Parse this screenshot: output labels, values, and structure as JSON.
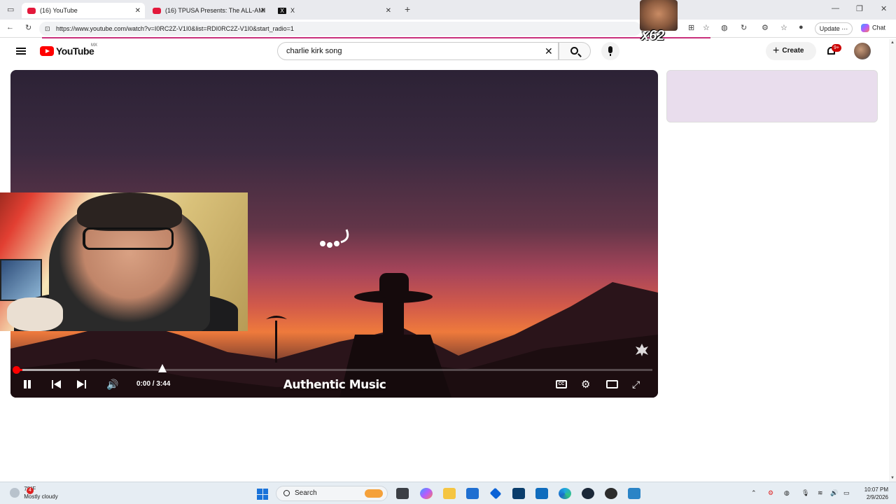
{
  "browser": {
    "tabs": [
      {
        "title": "(16) YouTube",
        "active": true
      },
      {
        "title": "(16) TPUSA Presents: The ALL-AMI",
        "active": false
      },
      {
        "title": "X",
        "active": false
      }
    ],
    "new_tab": "+",
    "url": "https://www.youtube.com/watch?v=I0RC2Z-V1I0&list=RDI0RC2Z-V1I0&start_radio=1",
    "update_label": "Update",
    "chat_label": "Chat",
    "window_controls": [
      "—",
      "❐",
      "✕"
    ]
  },
  "youtube": {
    "logo_text": "YouTube",
    "country_code": "MX",
    "search_value": "charlie kirk song",
    "create_label": "Create",
    "notification_badge": "9+"
  },
  "player": {
    "time_display": "0:00 / 3:44",
    "watermark": "Authentic Music",
    "cc_label": "CC",
    "progress_played_fraction": 0.01,
    "progress_buffered_fraction": 0.1
  },
  "overlay": {
    "emote_count": "x62"
  },
  "taskbar": {
    "weather_temp": "78°F",
    "weather_desc": "Mostly cloudy",
    "weather_badge": "4",
    "search_label": "Search",
    "time": "10:07 PM",
    "date": "2/9/2026"
  },
  "colors": {
    "youtube_red": "#ff0000",
    "load_line": "#c9307b",
    "side_card": "#e9dded"
  }
}
